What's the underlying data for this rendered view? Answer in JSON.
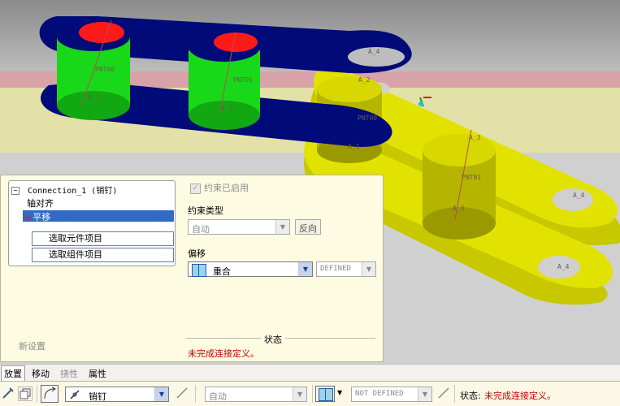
{
  "viewport": {
    "labels": {
      "pnt00": "PNT00",
      "pnt01a": "PNT01",
      "pnt00b": "PNT00",
      "pnt01b": "PNT01",
      "a1": "A_1",
      "a2": "A_2",
      "a3": "A_3",
      "a4": "A_4"
    }
  },
  "panel": {
    "tree": {
      "root": "Connection_1 (销钉)",
      "item1": "轴对齐",
      "item2": "平移",
      "collect1": "选取元件项目",
      "collect2": "选取组件项目"
    },
    "new_set": "新设置",
    "constraint_enabled": "约束已启用",
    "constraint_type_label": "约束类型",
    "constraint_type_value": "自动",
    "flip_button": "反向",
    "offset_label": "偏移",
    "offset_value": "重合",
    "offset_status": "DEFINED",
    "status_title": "状态",
    "status_message": "未完成连接定义。"
  },
  "tabs": [
    "放置",
    "移动",
    "挠性",
    "属性"
  ],
  "toolbar": {
    "connection_type": "销钉",
    "constraint_auto": "自动",
    "not_defined": "NOT DEFINED",
    "status_label": "状态:",
    "status_message": "未完成连接定义。"
  },
  "colors": {
    "blue_links": "#000a78",
    "green_pins": "#19d819",
    "red_top": "#ff1a1a",
    "yellow_links": "#d7d700",
    "panel_bg": "#fdfbe1",
    "selection": "#316ac5"
  }
}
